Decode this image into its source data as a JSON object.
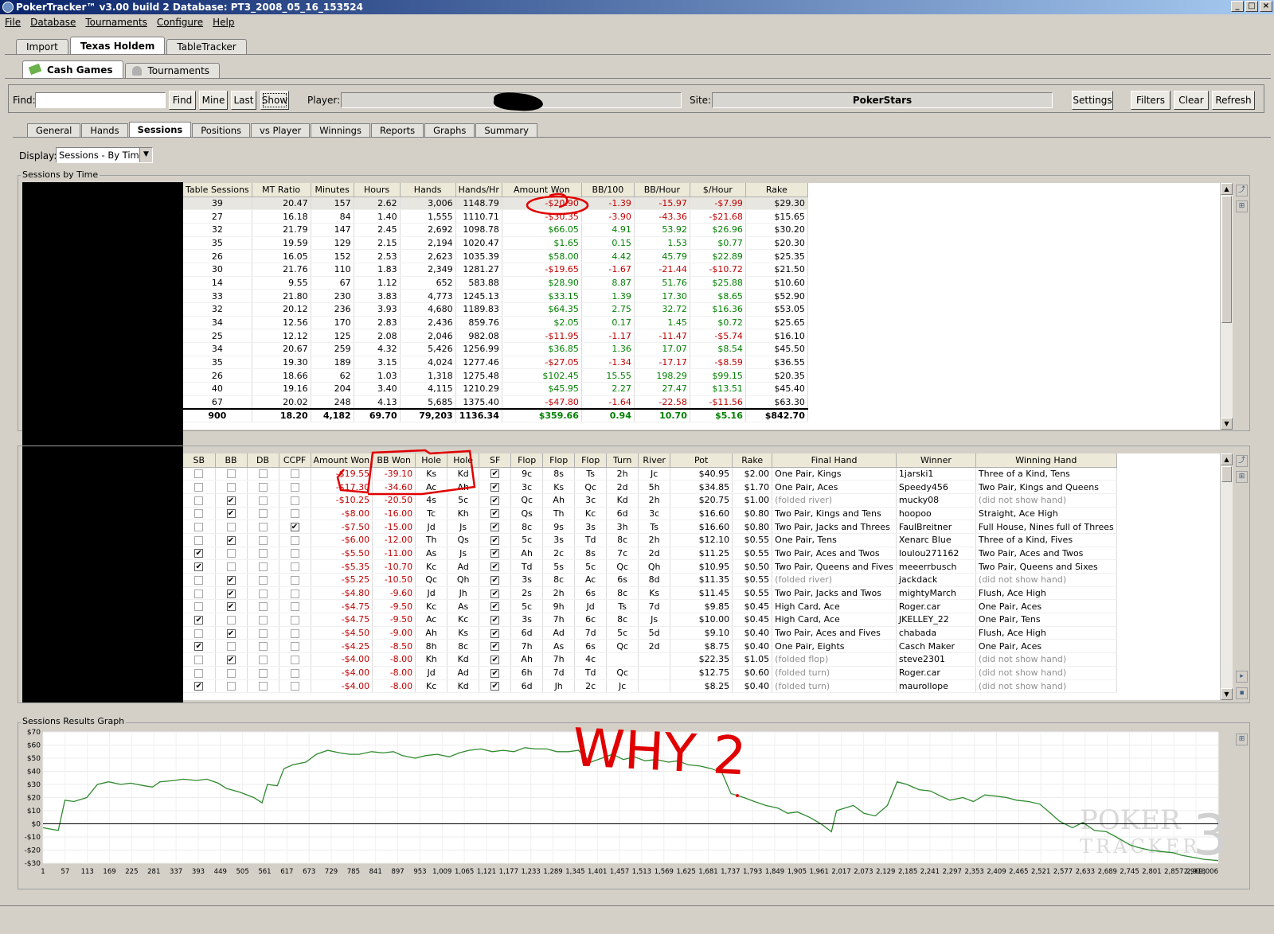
{
  "window": {
    "title": "PokerTracker™ v3.00 build 2  Database: PT3_2008_05_16_153524"
  },
  "menu": [
    "File",
    "Database",
    "Tournaments",
    "Configure",
    "Help"
  ],
  "main_tabs": [
    "Import",
    "Texas Holdem",
    "TableTracker"
  ],
  "game_tabs": [
    "Cash Games",
    "Tournaments"
  ],
  "toolbar": {
    "find_label": "Find:",
    "find_value": "",
    "find_btn": "Find",
    "mine_btn": "Mine",
    "last_btn": "Last",
    "show_btn": "Show",
    "player_label": "Player:",
    "player_value": "",
    "site_label": "Site:",
    "site_value": "PokerStars",
    "settings_btn": "Settings",
    "filters_btn": "Filters",
    "clear_btn": "Clear",
    "refresh_btn": "Refresh"
  },
  "report_tabs": [
    "General",
    "Hands",
    "Sessions",
    "Positions",
    "vs Player",
    "Winnings",
    "Reports",
    "Graphs",
    "Summary"
  ],
  "display": {
    "label": "Display:",
    "value": "Sessions - By Time"
  },
  "sessions": {
    "group_title": "Sessions by Time",
    "columns": [
      "Table Sessions",
      "MT Ratio",
      "Minutes",
      "Hours",
      "Hands",
      "Hands/Hr",
      "Amount Won",
      "BB/100",
      "BB/Hour",
      "$/Hour",
      "Rake"
    ],
    "rows": [
      [
        "39",
        "20.47",
        "157",
        "2.62",
        "3,006",
        "1148.79",
        "-$20.90",
        "-1.39",
        "-15.97",
        "-$7.99",
        "$29.30"
      ],
      [
        "27",
        "16.18",
        "84",
        "1.40",
        "1,555",
        "1110.71",
        "-$30.35",
        "-3.90",
        "-43.36",
        "-$21.68",
        "$15.65"
      ],
      [
        "32",
        "21.79",
        "147",
        "2.45",
        "2,692",
        "1098.78",
        "$66.05",
        "4.91",
        "53.92",
        "$26.96",
        "$30.20"
      ],
      [
        "35",
        "19.59",
        "129",
        "2.15",
        "2,194",
        "1020.47",
        "$1.65",
        "0.15",
        "1.53",
        "$0.77",
        "$20.30"
      ],
      [
        "26",
        "16.05",
        "152",
        "2.53",
        "2,623",
        "1035.39",
        "$58.00",
        "4.42",
        "45.79",
        "$22.89",
        "$25.35"
      ],
      [
        "30",
        "21.76",
        "110",
        "1.83",
        "2,349",
        "1281.27",
        "-$19.65",
        "-1.67",
        "-21.44",
        "-$10.72",
        "$21.50"
      ],
      [
        "14",
        "9.55",
        "67",
        "1.12",
        "652",
        "583.88",
        "$28.90",
        "8.87",
        "51.76",
        "$25.88",
        "$10.60"
      ],
      [
        "33",
        "21.80",
        "230",
        "3.83",
        "4,773",
        "1245.13",
        "$33.15",
        "1.39",
        "17.30",
        "$8.65",
        "$52.90"
      ],
      [
        "32",
        "20.12",
        "236",
        "3.93",
        "4,680",
        "1189.83",
        "$64.35",
        "2.75",
        "32.72",
        "$16.36",
        "$53.05"
      ],
      [
        "34",
        "12.56",
        "170",
        "2.83",
        "2,436",
        "859.76",
        "$2.05",
        "0.17",
        "1.45",
        "$0.72",
        "$25.65"
      ],
      [
        "25",
        "12.12",
        "125",
        "2.08",
        "2,046",
        "982.08",
        "-$11.95",
        "-1.17",
        "-11.47",
        "-$5.74",
        "$16.10"
      ],
      [
        "34",
        "20.67",
        "259",
        "4.32",
        "5,426",
        "1256.99",
        "$36.85",
        "1.36",
        "17.07",
        "$8.54",
        "$45.50"
      ],
      [
        "35",
        "19.30",
        "189",
        "3.15",
        "4,024",
        "1277.46",
        "-$27.05",
        "-1.34",
        "-17.17",
        "-$8.59",
        "$36.55"
      ],
      [
        "26",
        "18.66",
        "62",
        "1.03",
        "1,318",
        "1275.48",
        "$102.45",
        "15.55",
        "198.29",
        "$99.15",
        "$20.35"
      ],
      [
        "40",
        "19.16",
        "204",
        "3.40",
        "4,115",
        "1210.29",
        "$45.95",
        "2.27",
        "27.47",
        "$13.51",
        "$45.40"
      ],
      [
        "67",
        "20.02",
        "248",
        "4.13",
        "5,685",
        "1375.40",
        "-$47.80",
        "-1.64",
        "-22.58",
        "-$11.56",
        "$63.30"
      ]
    ],
    "total": [
      "900",
      "18.20",
      "4,182",
      "69.70",
      "79,203",
      "1136.34",
      "$359.66",
      "0.94",
      "10.70",
      "$5.16",
      "$842.70"
    ]
  },
  "hands": {
    "columns": [
      "SB",
      "BB",
      "DB",
      "CCPF",
      "Amount Won",
      "BB Won",
      "Hole",
      "Hole",
      "SF",
      "Flop",
      "Flop",
      "Flop",
      "Turn",
      "River",
      "Pot",
      "Rake",
      "Final Hand",
      "Winner",
      "Winning Hand"
    ],
    "rows": [
      {
        "sb": false,
        "bb": false,
        "db": false,
        "ccpf": false,
        "amt": "-$19.55",
        "bbw": "-39.10",
        "h1": "Ks",
        "h2": "Kd",
        "sf": true,
        "f1": "9c",
        "f2": "8s",
        "f3": "Ts",
        "turn": "2h",
        "river": "Jc",
        "pot": "$40.95",
        "rake": "$2.00",
        "final": "One Pair, Kings",
        "winner": "1jarski1",
        "winhand": "Three of a Kind, Tens"
      },
      {
        "sb": false,
        "bb": false,
        "db": false,
        "ccpf": false,
        "amt": "-$17.30",
        "bbw": "-34.60",
        "h1": "Ac",
        "h2": "Ah",
        "sf": true,
        "f1": "3c",
        "f2": "Ks",
        "f3": "Qc",
        "turn": "2d",
        "river": "5h",
        "pot": "$34.85",
        "rake": "$1.70",
        "final": "One Pair, Aces",
        "winner": "Speedy456",
        "winhand": "Two Pair, Kings and Queens"
      },
      {
        "sb": false,
        "bb": true,
        "db": false,
        "ccpf": false,
        "amt": "-$10.25",
        "bbw": "-20.50",
        "h1": "4s",
        "h2": "5c",
        "sf": true,
        "f1": "Qc",
        "f2": "Ah",
        "f3": "3c",
        "turn": "Kd",
        "river": "2h",
        "pot": "$20.75",
        "rake": "$1.00",
        "final": "(folded river)",
        "winner": "mucky08",
        "winhand": "(did not show hand)"
      },
      {
        "sb": false,
        "bb": true,
        "db": false,
        "ccpf": false,
        "amt": "-$8.00",
        "bbw": "-16.00",
        "h1": "Tc",
        "h2": "Kh",
        "sf": true,
        "f1": "Qs",
        "f2": "Th",
        "f3": "Kc",
        "turn": "6d",
        "river": "3c",
        "pot": "$16.60",
        "rake": "$0.80",
        "final": "Two Pair, Kings and Tens",
        "winner": "hoopoo",
        "winhand": "Straight, Ace High"
      },
      {
        "sb": false,
        "bb": false,
        "db": false,
        "ccpf": true,
        "amt": "-$7.50",
        "bbw": "-15.00",
        "h1": "Jd",
        "h2": "Js",
        "sf": true,
        "f1": "8c",
        "f2": "9s",
        "f3": "3s",
        "turn": "3h",
        "river": "Ts",
        "pot": "$16.60",
        "rake": "$0.80",
        "final": "Two Pair, Jacks and Threes",
        "winner": "FaulBreitner",
        "winhand": "Full House, Nines full of Threes"
      },
      {
        "sb": false,
        "bb": true,
        "db": false,
        "ccpf": false,
        "amt": "-$6.00",
        "bbw": "-12.00",
        "h1": "Th",
        "h2": "Qs",
        "sf": true,
        "f1": "5c",
        "f2": "3s",
        "f3": "Td",
        "turn": "8c",
        "river": "2h",
        "pot": "$12.10",
        "rake": "$0.55",
        "final": "One Pair, Tens",
        "winner": "Xenarc Blue",
        "winhand": "Three of a Kind, Fives"
      },
      {
        "sb": true,
        "bb": false,
        "db": false,
        "ccpf": false,
        "amt": "-$5.50",
        "bbw": "-11.00",
        "h1": "As",
        "h2": "Js",
        "sf": true,
        "f1": "Ah",
        "f2": "2c",
        "f3": "8s",
        "turn": "7c",
        "river": "2d",
        "pot": "$11.25",
        "rake": "$0.55",
        "final": "Two Pair, Aces and Twos",
        "winner": "loulou271162",
        "winhand": "Two Pair, Aces and Twos"
      },
      {
        "sb": true,
        "bb": false,
        "db": false,
        "ccpf": false,
        "amt": "-$5.35",
        "bbw": "-10.70",
        "h1": "Kc",
        "h2": "Ad",
        "sf": true,
        "f1": "Td",
        "f2": "5s",
        "f3": "5c",
        "turn": "Qc",
        "river": "Qh",
        "pot": "$10.95",
        "rake": "$0.50",
        "final": "Two Pair, Queens and Fives",
        "winner": "meeerrbusch",
        "winhand": "Two Pair, Queens and Sixes"
      },
      {
        "sb": false,
        "bb": true,
        "db": false,
        "ccpf": false,
        "amt": "-$5.25",
        "bbw": "-10.50",
        "h1": "Qc",
        "h2": "Qh",
        "sf": true,
        "f1": "3s",
        "f2": "8c",
        "f3": "Ac",
        "turn": "6s",
        "river": "8d",
        "pot": "$11.35",
        "rake": "$0.55",
        "final": "(folded river)",
        "winner": "jackdack",
        "winhand": "(did not show hand)"
      },
      {
        "sb": false,
        "bb": true,
        "db": false,
        "ccpf": false,
        "amt": "-$4.80",
        "bbw": "-9.60",
        "h1": "Jd",
        "h2": "Jh",
        "sf": true,
        "f1": "2s",
        "f2": "2h",
        "f3": "6s",
        "turn": "8c",
        "river": "Ks",
        "pot": "$11.45",
        "rake": "$0.55",
        "final": "Two Pair, Jacks and Twos",
        "winner": "mightyMarch",
        "winhand": "Flush, Ace High"
      },
      {
        "sb": false,
        "bb": true,
        "db": false,
        "ccpf": false,
        "amt": "-$4.75",
        "bbw": "-9.50",
        "h1": "Kc",
        "h2": "As",
        "sf": true,
        "f1": "5c",
        "f2": "9h",
        "f3": "Jd",
        "turn": "Ts",
        "river": "7d",
        "pot": "$9.85",
        "rake": "$0.45",
        "final": "High Card, Ace",
        "winner": "Roger.car",
        "winhand": "One Pair, Aces"
      },
      {
        "sb": true,
        "bb": false,
        "db": false,
        "ccpf": false,
        "amt": "-$4.75",
        "bbw": "-9.50",
        "h1": "Ac",
        "h2": "Kc",
        "sf": true,
        "f1": "3s",
        "f2": "7h",
        "f3": "6c",
        "turn": "8c",
        "river": "Js",
        "pot": "$10.00",
        "rake": "$0.45",
        "final": "High Card, Ace",
        "winner": "JKELLEY_22",
        "winhand": "One Pair, Tens"
      },
      {
        "sb": false,
        "bb": true,
        "db": false,
        "ccpf": false,
        "amt": "-$4.50",
        "bbw": "-9.00",
        "h1": "Ah",
        "h2": "Ks",
        "sf": true,
        "f1": "6d",
        "f2": "Ad",
        "f3": "7d",
        "turn": "5c",
        "river": "5d",
        "pot": "$9.10",
        "rake": "$0.40",
        "final": "Two Pair, Aces and Fives",
        "winner": "chabada",
        "winhand": "Flush, Ace High"
      },
      {
        "sb": true,
        "bb": false,
        "db": false,
        "ccpf": false,
        "amt": "-$4.25",
        "bbw": "-8.50",
        "h1": "8h",
        "h2": "8c",
        "sf": true,
        "f1": "7h",
        "f2": "As",
        "f3": "6s",
        "turn": "Qc",
        "river": "2d",
        "pot": "$8.75",
        "rake": "$0.40",
        "final": "One Pair, Eights",
        "winner": "Casch Maker",
        "winhand": "One Pair, Aces"
      },
      {
        "sb": false,
        "bb": true,
        "db": false,
        "ccpf": false,
        "amt": "-$4.00",
        "bbw": "-8.00",
        "h1": "Kh",
        "h2": "Kd",
        "sf": true,
        "f1": "Ah",
        "f2": "7h",
        "f3": "4c",
        "turn": "",
        "river": "",
        "pot": "$22.35",
        "rake": "$1.05",
        "final": "(folded flop)",
        "winner": "steve2301",
        "winhand": "(did not show hand)"
      },
      {
        "sb": false,
        "bb": false,
        "db": false,
        "ccpf": false,
        "amt": "-$4.00",
        "bbw": "-8.00",
        "h1": "Jd",
        "h2": "Ad",
        "sf": true,
        "f1": "6h",
        "f2": "7d",
        "f3": "Td",
        "turn": "Qc",
        "river": "",
        "pot": "$12.75",
        "rake": "$0.60",
        "final": "(folded turn)",
        "winner": "Roger.car",
        "winhand": "(did not show hand)"
      },
      {
        "sb": true,
        "bb": false,
        "db": false,
        "ccpf": false,
        "amt": "-$4.00",
        "bbw": "-8.00",
        "h1": "Kc",
        "h2": "Kd",
        "sf": true,
        "f1": "6d",
        "f2": "Jh",
        "f3": "2c",
        "turn": "Jc",
        "river": "",
        "pot": "$8.25",
        "rake": "$0.40",
        "final": "(folded turn)",
        "winner": "maurollope",
        "winhand": "(did not show hand)"
      }
    ]
  },
  "graph_group_title": "Sessions Results Graph",
  "annotation_text": "WHY 2",
  "watermark": {
    "line1": "POKER",
    "line2": "TRACKER",
    "num": "3"
  },
  "chart_data": {
    "type": "line",
    "ylim": [
      -30,
      70
    ],
    "yticks": [
      "$70",
      "$60",
      "$50",
      "$40",
      "$30",
      "$20",
      "$10",
      "$0",
      "-$10",
      "-$20",
      "-$30"
    ],
    "xticks": [
      "1",
      "57",
      "113",
      "169",
      "225",
      "281",
      "337",
      "393",
      "449",
      "505",
      "561",
      "617",
      "673",
      "729",
      "785",
      "841",
      "897",
      "953",
      "1,009",
      "1,065",
      "1,121",
      "1,177",
      "1,233",
      "1,289",
      "1,345",
      "1,401",
      "1,457",
      "1,513",
      "1,569",
      "1,625",
      "1,681",
      "1,737",
      "1,793",
      "1,849",
      "1,905",
      "1,961",
      "2,017",
      "2,073",
      "2,129",
      "2,185",
      "2,241",
      "2,297",
      "2,353",
      "2,409",
      "2,465",
      "2,521",
      "2,577",
      "2,633",
      "2,689",
      "2,745",
      "2,801",
      "2,857",
      "2,913",
      "2,969,006"
    ],
    "xmax": 3006,
    "series": [
      {
        "color": "#2f8a2f",
        "x": [
          1,
          20,
          40,
          57,
          80,
          113,
          140,
          169,
          200,
          225,
          260,
          281,
          300,
          337,
          360,
          393,
          420,
          449,
          470,
          505,
          540,
          561,
          575,
          600,
          617,
          640,
          673,
          700,
          729,
          760,
          785,
          810,
          841,
          870,
          897,
          920,
          953,
          980,
          1009,
          1040,
          1065,
          1090,
          1121,
          1150,
          1177,
          1205,
          1233,
          1260,
          1289,
          1315,
          1345,
          1370,
          1401,
          1430,
          1457,
          1485,
          1513,
          1540,
          1569,
          1600,
          1625,
          1650,
          1681,
          1710,
          1737,
          1760,
          1793,
          1820,
          1849,
          1880,
          1905,
          1930,
          1961,
          1990,
          2017,
          2030,
          2073,
          2100,
          2129,
          2160,
          2185,
          2210,
          2241,
          2270,
          2297,
          2320,
          2353,
          2380,
          2409,
          2440,
          2465,
          2490,
          2521,
          2550,
          2577,
          2600,
          2633,
          2660,
          2689,
          2720,
          2745,
          2780,
          2801,
          2830,
          2857,
          2890,
          2913,
          2950,
          2969,
          3006
        ],
        "y": [
          -3,
          -4,
          -5,
          18,
          17,
          20,
          30,
          32,
          30,
          31,
          29,
          28,
          32,
          33,
          34,
          33,
          34,
          31,
          27,
          24,
          20,
          16,
          30,
          29,
          42,
          45,
          47,
          53,
          56,
          54,
          53,
          53,
          55,
          54,
          55,
          52,
          50,
          52,
          53,
          51,
          54,
          56,
          57,
          55,
          56,
          55,
          58,
          57,
          57,
          55,
          55,
          56,
          47,
          50,
          53,
          49,
          51,
          48,
          49,
          47,
          48,
          45,
          44,
          42,
          39,
          23,
          20,
          17,
          14,
          12,
          8,
          9,
          5,
          0,
          -6,
          10,
          14,
          8,
          6,
          14,
          32,
          30,
          26,
          25,
          21,
          18,
          20,
          17,
          22,
          21,
          20,
          18,
          17,
          15,
          8,
          2,
          -3,
          1,
          -5,
          -6,
          -10,
          -16,
          -18,
          -20,
          -21,
          -22,
          -24,
          -26,
          -27,
          -28
        ]
      }
    ]
  }
}
